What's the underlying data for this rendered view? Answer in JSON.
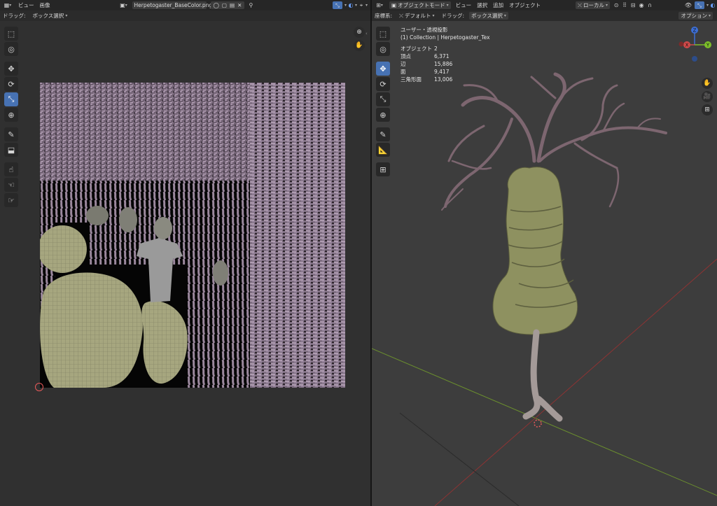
{
  "uv_editor": {
    "header": {
      "view_menu": "ビュー",
      "image_menu": "画像",
      "image_name": "Herpetogaster_BaseColor.png"
    },
    "subheader": {
      "drag_label": "ドラッグ:",
      "drag_mode": "ボックス選択"
    }
  },
  "viewport": {
    "header": {
      "mode": "オブジェクトモード",
      "menus": [
        "ビュー",
        "選択",
        "追加",
        "オブジェクト"
      ],
      "transform_orientation": "ローカル"
    },
    "subheader": {
      "orientation_label": "座標系:",
      "orientation_value": "デフォルト",
      "drag_label": "ドラッグ:",
      "drag_mode": "ボックス選択",
      "options": "オプション"
    },
    "overlay": {
      "view_name": "ユーザー・透視投影",
      "collection_line": "(1) Collection | Herpetogaster_Tex",
      "stats": [
        {
          "label": "オブジェクト",
          "value": "2"
        },
        {
          "label": "頂点",
          "value": "6,371"
        },
        {
          "label": "辺",
          "value": "15,886"
        },
        {
          "label": "面",
          "value": "9,417"
        },
        {
          "label": "三角形面",
          "value": "13,006"
        }
      ]
    },
    "gizmo": {
      "z": "Z",
      "y": "Y",
      "x": "X"
    }
  },
  "colors": {
    "accent": "#4772b3",
    "texture_purple": "#8d7b8f",
    "texture_green": "#a3a37a"
  }
}
